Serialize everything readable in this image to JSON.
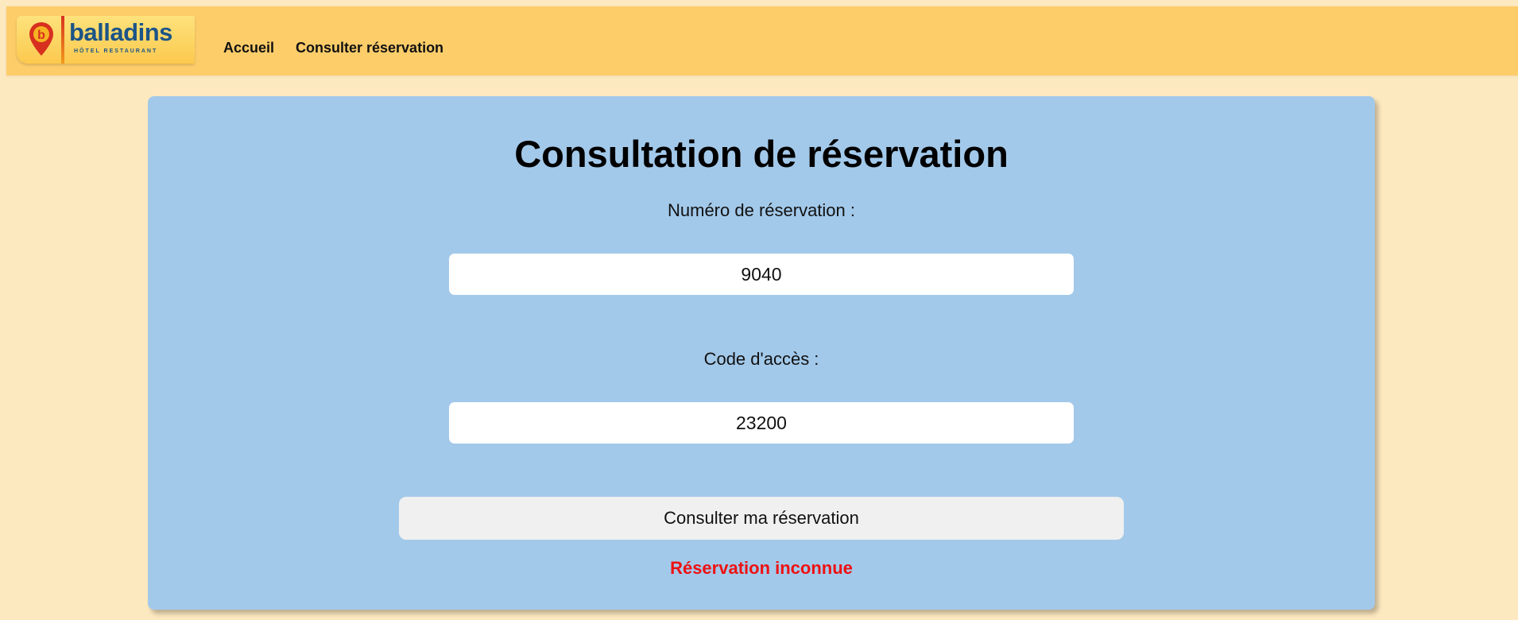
{
  "header": {
    "logo": {
      "brand": "balladins",
      "tagline": "HÔTEL RESTAURANT",
      "icon": "map-pin-b-icon"
    },
    "nav": [
      {
        "label": "Accueil"
      },
      {
        "label": "Consulter réservation"
      }
    ]
  },
  "main": {
    "title": "Consultation de réservation",
    "reservation_number": {
      "label": "Numéro de réservation :",
      "value": "9040"
    },
    "access_code": {
      "label": "Code d'accès :",
      "value": "23200"
    },
    "submit_label": "Consulter ma réservation",
    "error_message": "Réservation inconnue"
  },
  "colors": {
    "page_background": "#fde9bf",
    "navbar": "#fdcd6a",
    "card": "#a3c9ea",
    "error": "#ee1111",
    "brand_blue": "#1b5487"
  }
}
